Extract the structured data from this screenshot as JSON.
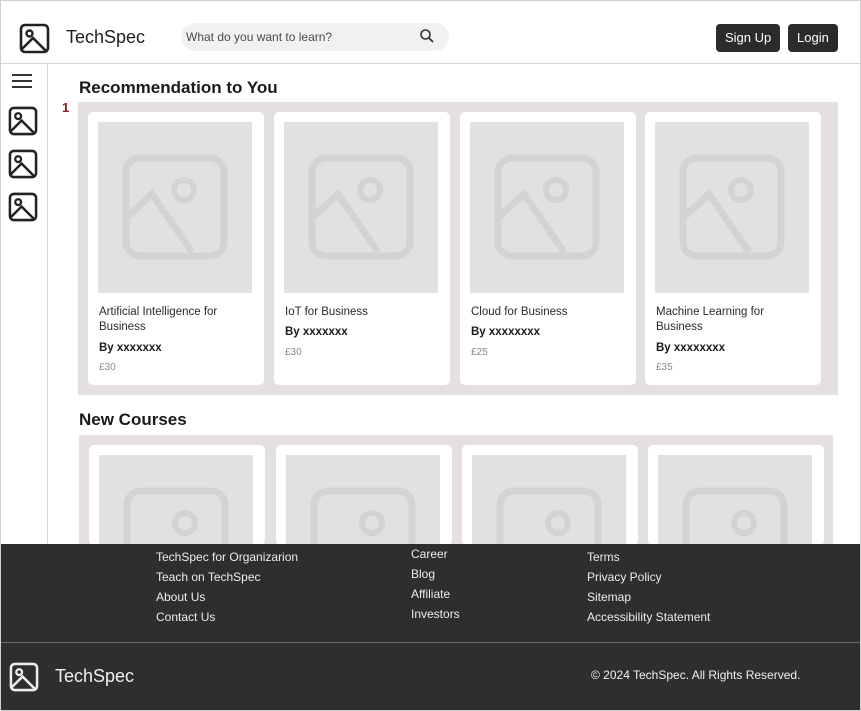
{
  "header": {
    "brand": "TechSpec",
    "search_placeholder": "What do you want to learn?",
    "signup_label": "Sign Up",
    "login_label": "Login"
  },
  "sidebar": {
    "items": [
      {
        "icon": "image-icon"
      },
      {
        "icon": "image-icon"
      },
      {
        "icon": "image-icon"
      }
    ]
  },
  "recommendations": {
    "title": "Recommendation to You",
    "rank_marker": "1",
    "cards": [
      {
        "title": "Artificial Intelligence for Business",
        "author": "By xxxxxxx",
        "price": "£30"
      },
      {
        "title": "IoT for Business",
        "author": "By xxxxxxx",
        "price": "£30"
      },
      {
        "title": "Cloud for Business",
        "author": "By xxxxxxxx",
        "price": "£25"
      },
      {
        "title": "Machine Learning for Business",
        "author": "By xxxxxxxx",
        "price": "£35"
      }
    ]
  },
  "new_courses": {
    "title": "New Courses"
  },
  "footer": {
    "col1": [
      "TechSpec for Organizarion",
      "Teach on TechSpec",
      "About Us",
      "Contact Us"
    ],
    "col2": [
      "Career",
      "Blog",
      "Affiliate",
      "Investors"
    ],
    "col3": [
      "Terms",
      "Privacy Policy",
      "Sitemap",
      "Accessibility Statement"
    ],
    "brand": "TechSpec",
    "copyright": "© 2024 TechSpec. All Rights Reserved."
  }
}
